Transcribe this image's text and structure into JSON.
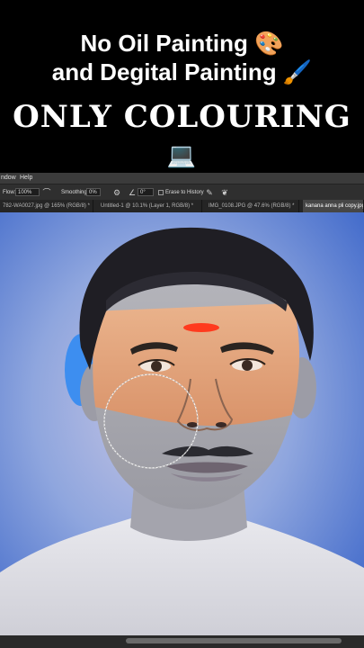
{
  "caption": {
    "line1_text": "No Oil Painting",
    "line1_emoji": "🎨",
    "line2_text": "and Degital Painting",
    "line2_emoji": "🖌️",
    "line3_text": "ONLY COLOURING",
    "line3_emoji": "💻"
  },
  "menubar": {
    "window": "ndow",
    "help": "Help"
  },
  "options": {
    "flow_label": "Flow:",
    "flow_value": "100%",
    "smoothing_label": "Smoothing:",
    "smoothing_value": "0%",
    "angle_value": "0°",
    "erase_history_label": "Erase to History"
  },
  "tabs": [
    {
      "label": "782-WA0027.jpg @ 165% (RGB/8) *"
    },
    {
      "label": "Untitled-1 @ 10.1% (Layer 1, RGB/8) *"
    },
    {
      "label": "IMG_0108.JPG @ 47.6% (RGB/8) *"
    },
    {
      "label": "kanana anna pli copy.jpg"
    }
  ],
  "colors": {
    "ps_dark": "#2f2f2f",
    "canvas_blue": "#3b66c4",
    "skin_painted": "#e8a37a"
  }
}
